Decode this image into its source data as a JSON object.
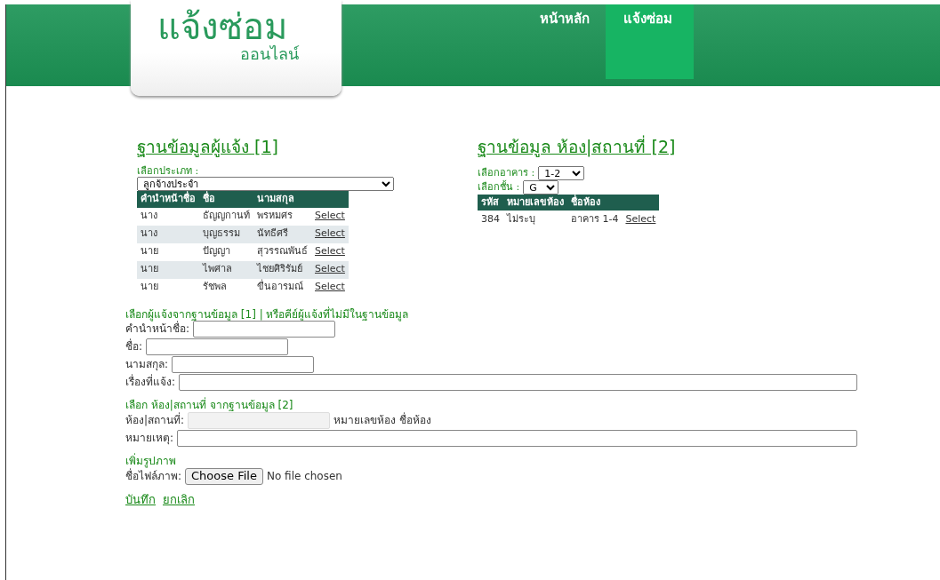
{
  "header": {
    "logo_title": "แจ้งซ่อม",
    "logo_subtitle": "ออนไลน์",
    "nav": [
      {
        "label": "หน้าหลัก",
        "selected": false
      },
      {
        "label": "แจ้งซ่อม",
        "selected": true
      }
    ]
  },
  "reporter_db": {
    "title": "ฐานข้อมูลผู้แจ้ง [1]",
    "type_label": "เลือกประเภท :",
    "type_value": "ลูกจ้างประจำ",
    "columns": [
      "คำนำหน้าชื่อ",
      "ชื่อ",
      "นามสกุล"
    ],
    "rows": [
      {
        "cells": [
          "นาง",
          "ธัญญกานท์",
          "พรหมศร"
        ],
        "action": "Select"
      },
      {
        "cells": [
          "นาง",
          "บุญธรรม",
          "นัทธีศรี"
        ],
        "action": "Select"
      },
      {
        "cells": [
          "นาย",
          "ปัญญา",
          "สุวรรณพันธ์"
        ],
        "action": "Select"
      },
      {
        "cells": [
          "นาย",
          "ไพศาล",
          "ไชยศิริรัมย์"
        ],
        "action": "Select"
      },
      {
        "cells": [
          "นาย",
          "รัชพล",
          "ขื่นอารมณ์"
        ],
        "action": "Select"
      }
    ]
  },
  "room_db": {
    "title": "ฐานข้อมูล ห้อง|สถานที่ [2]",
    "building_label": "เลือกอาคาร :",
    "building_value": "1-2",
    "floor_label": "เลือกชั้น :",
    "floor_value": "G",
    "columns": [
      "รหัส",
      "หมายเลขห้อง",
      "ชื่อห้อง"
    ],
    "rows": [
      {
        "cells": [
          "384",
          "ไม่ระบุ",
          "อาคาร 1-4"
        ],
        "action": "Select"
      }
    ]
  },
  "reporter_form": {
    "heading": "เลือกผู้แจ้งจากฐานข้อมูล [1] | หรือคีย์ผู้แจ้งที่ไม่มีในฐานข้อมูล",
    "fields": [
      {
        "label": "คำนำหน้าชื่อ:",
        "kind": "short"
      },
      {
        "label": "ชื่อ:",
        "kind": "short"
      },
      {
        "label": "นามสกุล:",
        "kind": "short"
      },
      {
        "label": "เรื่องที่แจ้ง:",
        "kind": "wide"
      }
    ]
  },
  "room_form": {
    "heading": "เลือก ห้อง|สถานที่ จากฐานข้อมูล [2]",
    "fields": [
      {
        "label": "ห้อง|สถานที่:",
        "kind": "short",
        "disabled": true,
        "note": "หมายเลขห้อง ชื่อห้อง"
      },
      {
        "label": "หมายเหตุ:",
        "kind": "wide",
        "disabled": false
      }
    ]
  },
  "image_form": {
    "heading": "เพิ่มรูปภาพ",
    "file_label": "ชื่อไฟล์ภาพ:",
    "button": "Choose File",
    "status": "No file chosen"
  },
  "actions": [
    "บันทึก",
    "ยกเลิก"
  ]
}
